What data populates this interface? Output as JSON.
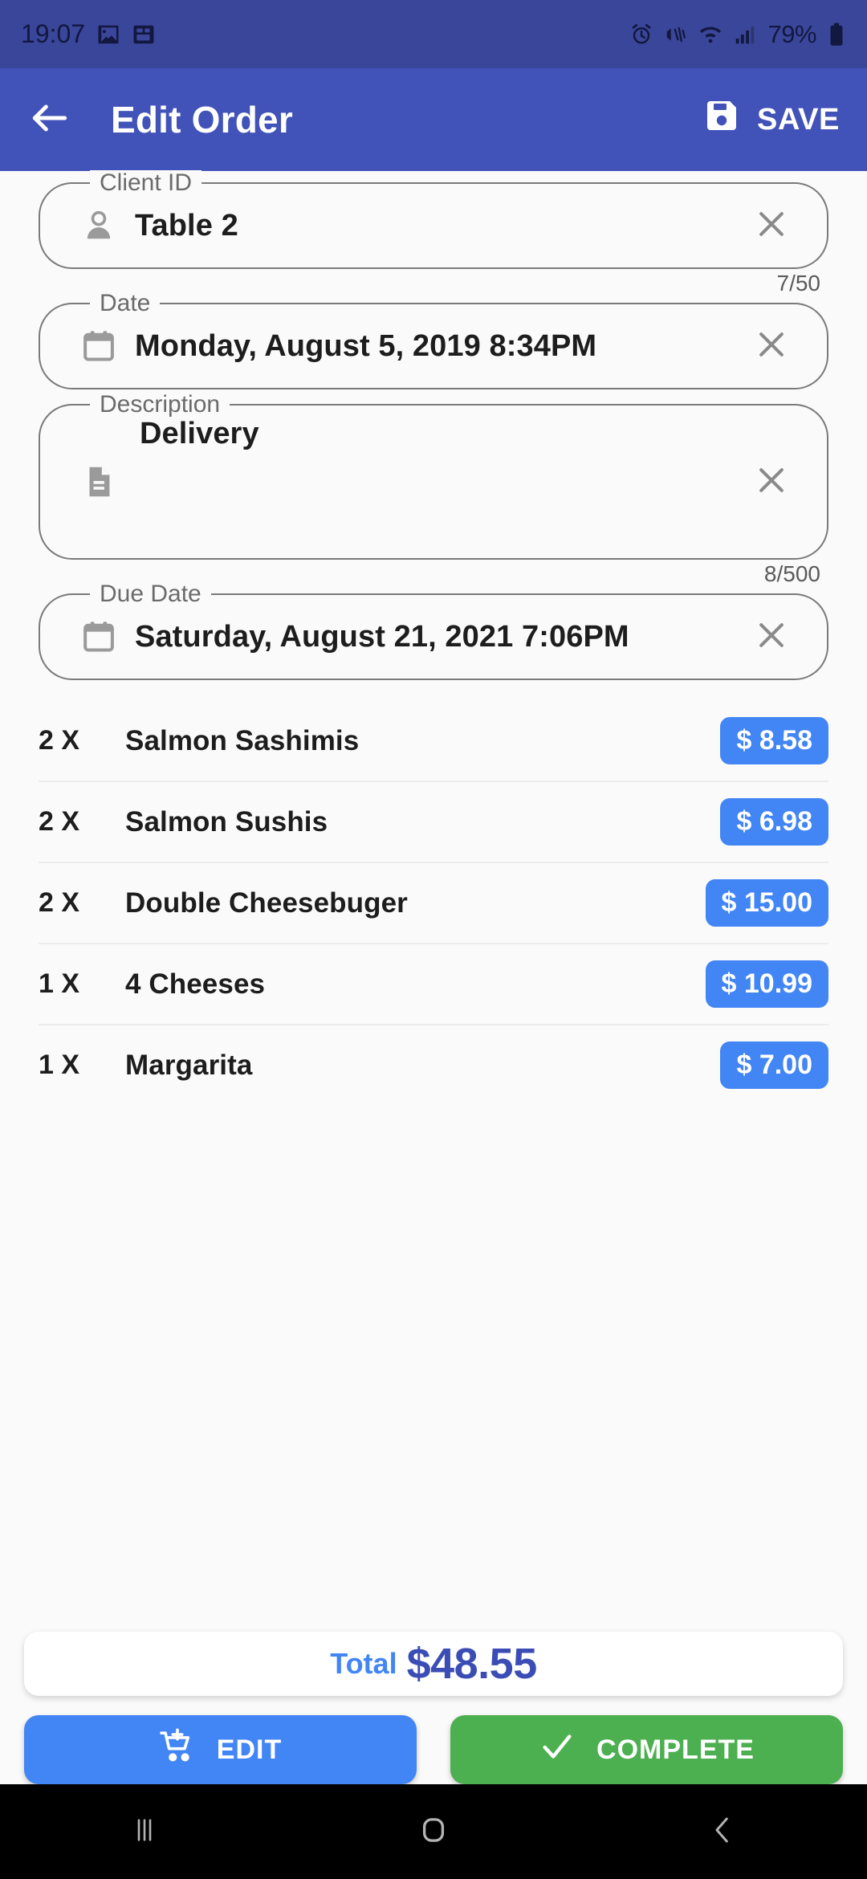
{
  "status_bar": {
    "time": "19:07",
    "battery_percent": "79%",
    "left_icons": [
      "image-icon",
      "qr-scan-icon"
    ],
    "right_icons": [
      "alarm-icon",
      "vibrate-icon",
      "wifi-icon",
      "signal-icon",
      "battery-icon"
    ],
    "bg_color": "#3a4699"
  },
  "app_bar": {
    "back_icon": "arrow-left-icon",
    "title": "Edit Order",
    "save_icon": "save-floppy-icon",
    "save_label": "SAVE",
    "bg_color": "#4152b8"
  },
  "form": {
    "client_id": {
      "label": "Client ID",
      "value": "Table 2",
      "icon": "person-icon",
      "clear_icon": "close-icon",
      "counter": "7/50"
    },
    "date": {
      "label": "Date",
      "value": "Monday, August 5, 2019 8:34PM",
      "icon": "calendar-icon",
      "clear_icon": "close-icon"
    },
    "description": {
      "label": "Description",
      "value": "Delivery",
      "icon": "document-icon",
      "clear_icon": "close-icon",
      "counter": "8/500"
    },
    "due_date": {
      "label": "Due Date",
      "value": "Saturday, August 21, 2021 7:06PM",
      "icon": "calendar-icon",
      "clear_icon": "close-icon"
    }
  },
  "items": [
    {
      "qty": "2 X",
      "name": "Salmon Sashimis",
      "price": "$ 8.58"
    },
    {
      "qty": "2 X",
      "name": "Salmon Sushis",
      "price": "$ 6.98"
    },
    {
      "qty": "2 X",
      "name": "Double Cheesebuger",
      "price": "$ 15.00"
    },
    {
      "qty": "1 X",
      "name": "4 Cheeses",
      "price": "$ 10.99"
    },
    {
      "qty": "1 X",
      "name": "Margarita",
      "price": "$ 7.00"
    }
  ],
  "footer": {
    "total_label": "Total",
    "total_value": "$48.55",
    "edit_label": "EDIT",
    "edit_icon": "add-to-cart-icon",
    "edit_color": "#4285f4",
    "complete_label": "COMPLETE",
    "complete_icon": "check-icon",
    "complete_color": "#4caf50"
  },
  "nav_bar": {
    "recents_icon": "recents-icon",
    "home_icon": "home-icon",
    "back_icon": "back-chevron-icon"
  }
}
